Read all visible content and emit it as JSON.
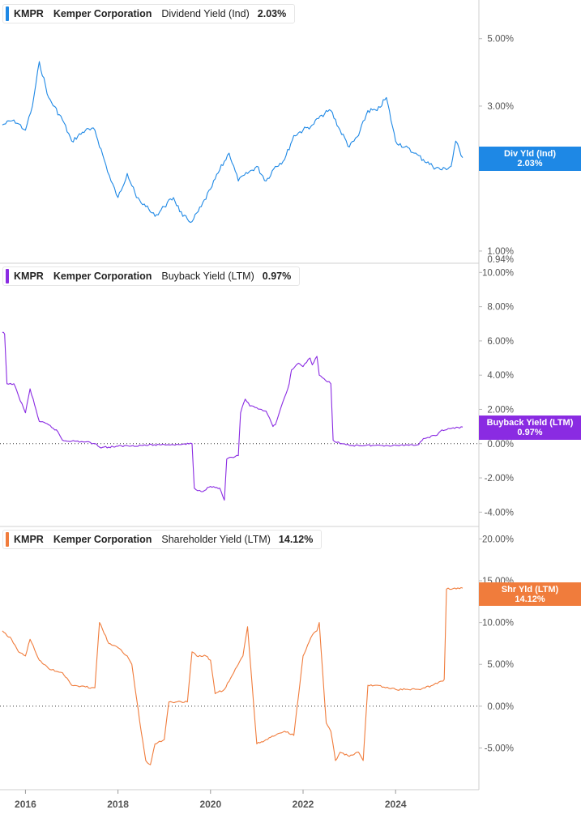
{
  "chart_data": [
    {
      "type": "line",
      "ticker": "KMPR",
      "company": "Kemper Corporation",
      "metric": "Dividend Yield (Ind)",
      "value": "2.03%",
      "badge_label": "Div Yld (Ind)",
      "badge_value": "2.03%",
      "color": "#1e88e5",
      "yscale": "log",
      "ylim": [
        0.94,
        6.5
      ],
      "yticks": [
        "5.00%",
        "3.00%",
        "2.00%",
        "1.00%"
      ],
      "ytick_values": [
        5,
        3,
        2,
        1
      ],
      "extra_ytick": "0.94%",
      "extra_ytick_value": 0.94,
      "x": [
        2015.5,
        2015.75,
        2016.0,
        2016.15,
        2016.3,
        2016.5,
        2016.8,
        2017.0,
        2017.3,
        2017.5,
        2017.7,
        2017.85,
        2018.0,
        2018.2,
        2018.4,
        2018.6,
        2018.8,
        2019.0,
        2019.2,
        2019.4,
        2019.6,
        2019.8,
        2020.0,
        2020.2,
        2020.4,
        2020.6,
        2020.8,
        2021.0,
        2021.2,
        2021.4,
        2021.6,
        2021.8,
        2022.0,
        2022.2,
        2022.4,
        2022.6,
        2022.8,
        2023.0,
        2023.2,
        2023.4,
        2023.6,
        2023.8,
        2024.0,
        2024.2,
        2024.4,
        2024.6,
        2024.8,
        2025.0,
        2025.2,
        2025.3,
        2025.45
      ],
      "values": [
        2.6,
        2.7,
        2.5,
        3.0,
        4.2,
        3.2,
        2.7,
        2.3,
        2.5,
        2.5,
        2.0,
        1.7,
        1.5,
        1.8,
        1.5,
        1.4,
        1.3,
        1.4,
        1.5,
        1.3,
        1.25,
        1.4,
        1.6,
        1.85,
        2.1,
        1.7,
        1.8,
        1.9,
        1.7,
        1.9,
        2.0,
        2.4,
        2.5,
        2.6,
        2.8,
        2.9,
        2.5,
        2.2,
        2.4,
        2.9,
        2.9,
        3.2,
        2.3,
        2.2,
        2.1,
        2.0,
        1.9,
        1.85,
        1.9,
        2.3,
        2.03
      ]
    },
    {
      "type": "line",
      "ticker": "KMPR",
      "company": "Kemper Corporation",
      "metric": "Buyback Yield (LTM)",
      "value": "0.97%",
      "badge_label": "Buyback Yield (LTM)",
      "badge_value": "0.97%",
      "color": "#8a2be2",
      "ylim": [
        -4.6,
        10.3
      ],
      "yticks": [
        "10.00%",
        "8.00%",
        "6.00%",
        "4.00%",
        "2.00%",
        "0.00%",
        "-2.00%",
        "-4.00%"
      ],
      "ytick_values": [
        10,
        8,
        6,
        4,
        2,
        0,
        -2,
        -4
      ],
      "x": [
        2015.5,
        2015.55,
        2015.6,
        2015.75,
        2015.85,
        2016.0,
        2016.1,
        2016.3,
        2016.5,
        2016.7,
        2016.8,
        2017.0,
        2017.3,
        2017.5,
        2017.6,
        2017.8,
        2018.0,
        2018.5,
        2019.0,
        2019.3,
        2019.6,
        2019.65,
        2019.8,
        2020.0,
        2020.2,
        2020.3,
        2020.35,
        2020.6,
        2020.65,
        2020.75,
        2020.85,
        2021.0,
        2021.2,
        2021.35,
        2021.4,
        2021.7,
        2021.75,
        2021.9,
        2022.0,
        2022.15,
        2022.2,
        2022.3,
        2022.35,
        2022.45,
        2022.6,
        2022.65,
        2022.8,
        2023.0,
        2023.5,
        2024.0,
        2024.5,
        2024.6,
        2024.9,
        2025.0,
        2025.45
      ],
      "values": [
        6.5,
        6.4,
        3.5,
        3.5,
        2.8,
        1.8,
        3.2,
        1.3,
        1.1,
        0.7,
        0.2,
        0.15,
        0.1,
        0.0,
        -0.2,
        -0.2,
        -0.15,
        -0.1,
        -0.05,
        -0.05,
        0.0,
        -2.6,
        -2.8,
        -2.5,
        -2.6,
        -3.3,
        -0.9,
        -0.7,
        1.8,
        2.6,
        2.2,
        2.1,
        1.9,
        1.0,
        1.1,
        3.5,
        4.3,
        4.7,
        4.5,
        5.0,
        4.6,
        5.1,
        4.0,
        3.8,
        3.5,
        0.2,
        0.0,
        -0.1,
        -0.1,
        -0.1,
        -0.05,
        0.3,
        0.5,
        0.8,
        0.97
      ]
    },
    {
      "type": "line",
      "ticker": "KMPR",
      "company": "Kemper Corporation",
      "metric": "Shareholder Yield (LTM)",
      "value": "14.12%",
      "badge_label": "Shr Yld (LTM)",
      "badge_value": "14.12%",
      "color": "#f07c3c",
      "ylim": [
        -9.5,
        21.0
      ],
      "yticks": [
        "20.00%",
        "15.00%",
        "10.00%",
        "5.00%",
        "0.00%",
        "-5.00%"
      ],
      "ytick_values": [
        20,
        15,
        10,
        5,
        0,
        -5
      ],
      "x": [
        2015.5,
        2015.7,
        2015.85,
        2016.0,
        2016.1,
        2016.3,
        2016.5,
        2016.8,
        2017.0,
        2017.3,
        2017.5,
        2017.6,
        2017.8,
        2018.0,
        2018.2,
        2018.3,
        2018.5,
        2018.6,
        2018.7,
        2018.8,
        2019.0,
        2019.1,
        2019.5,
        2019.6,
        2019.7,
        2019.9,
        2020.0,
        2020.1,
        2020.3,
        2020.5,
        2020.7,
        2020.8,
        2021.0,
        2021.2,
        2021.4,
        2021.6,
        2021.8,
        2022.0,
        2022.2,
        2022.3,
        2022.35,
        2022.5,
        2022.6,
        2022.7,
        2022.8,
        2023.0,
        2023.2,
        2023.3,
        2023.4,
        2023.6,
        2024.0,
        2024.5,
        2024.8,
        2025.0,
        2025.05,
        2025.1,
        2025.45
      ],
      "values": [
        9.0,
        8.0,
        6.5,
        6.0,
        8.0,
        5.5,
        4.5,
        4.0,
        2.5,
        2.3,
        2.2,
        10.0,
        7.5,
        7.0,
        6.0,
        5.0,
        -3.0,
        -6.5,
        -7.0,
        -4.5,
        -4.0,
        0.5,
        0.5,
        6.5,
        6.0,
        6.0,
        5.5,
        1.5,
        2.0,
        4.0,
        6.0,
        9.5,
        -4.5,
        -4.0,
        -3.5,
        -3.0,
        -3.5,
        6.0,
        8.5,
        9.0,
        10.0,
        -2.0,
        -3.0,
        -6.5,
        -5.5,
        -6.0,
        -5.5,
        -6.5,
        2.5,
        2.5,
        2.0,
        2.0,
        2.5,
        3.0,
        3.2,
        14.0,
        14.12
      ]
    }
  ],
  "x_axis": {
    "labels": [
      "2016",
      "2018",
      "2020",
      "2022",
      "2024"
    ],
    "values": [
      2016,
      2018,
      2020,
      2022,
      2024
    ],
    "range": [
      2015.45,
      2025.8
    ]
  }
}
